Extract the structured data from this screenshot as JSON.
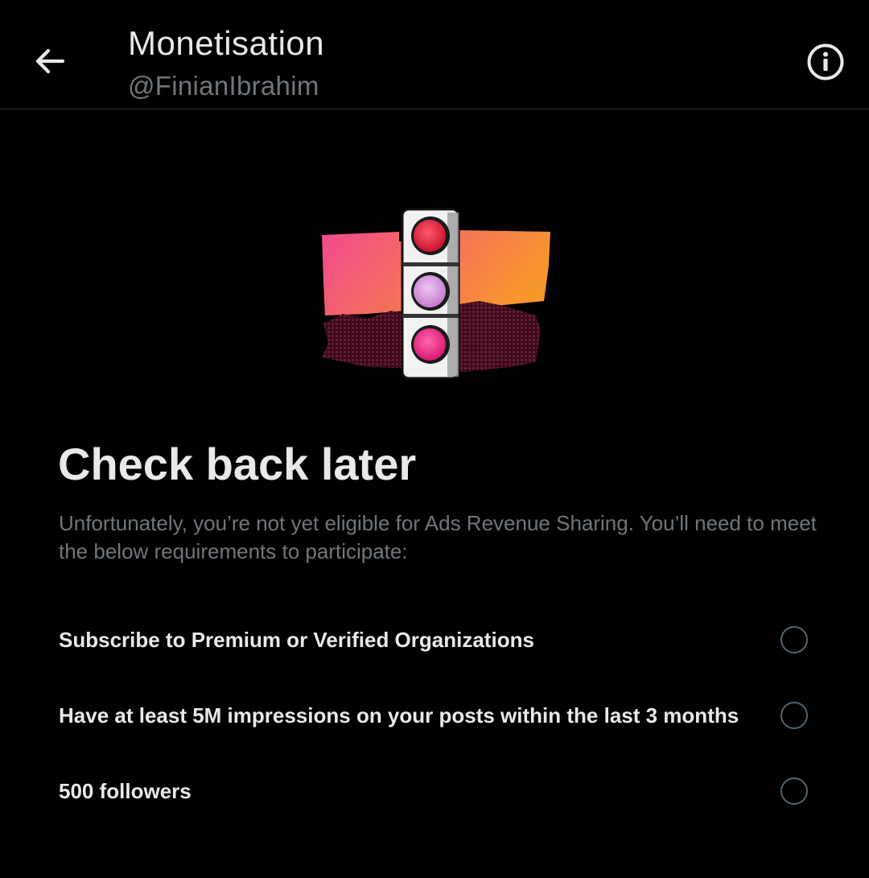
{
  "header": {
    "title": "Monetisation",
    "handle": "@FinianIbrahim",
    "back_icon": "arrow-left-icon",
    "info_icon": "info-circle-icon"
  },
  "illustration": {
    "icon": "traffic-light-illustration",
    "colors": {
      "red_light": "#e8203a",
      "lilac_light": "#d79be0",
      "pink_light": "#ef2d86",
      "sky_left": "#f2498f",
      "sky_right": "#f8962e",
      "ground": "#5a1429"
    }
  },
  "main": {
    "heading": "Check back later",
    "description": "Unfortunately, you’re not yet eligible for Ads Revenue Sharing. You’ll need to meet the below requirements to participate:"
  },
  "requirements": [
    {
      "label": "Subscribe to Premium or Verified Organizations",
      "checked": false
    },
    {
      "label": "Have at least 5M impressions on your posts within the last 3 months",
      "checked": false
    },
    {
      "label": "500 followers",
      "checked": false
    }
  ],
  "colors": {
    "background": "#000000",
    "primary_text": "#e7e9ea",
    "secondary_text": "#71767b",
    "divider": "#2f3336",
    "radio_border": "#536471"
  }
}
